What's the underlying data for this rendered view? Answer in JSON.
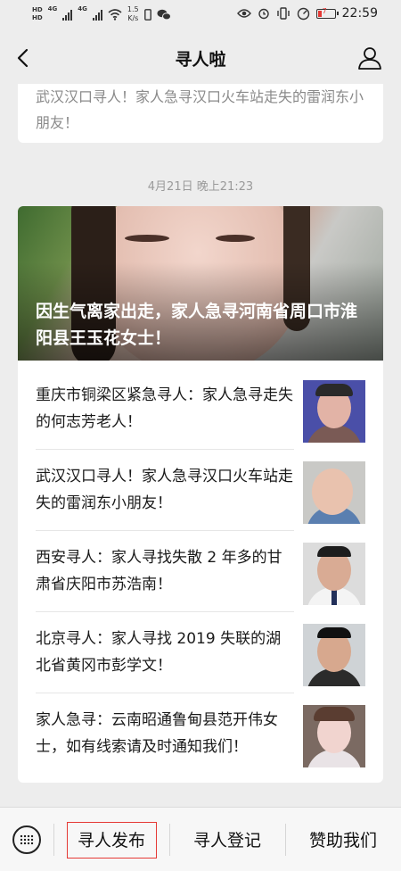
{
  "status_bar": {
    "net_speed_value": "1.5",
    "net_speed_unit": "K/s",
    "signal_label_1": "4G",
    "signal_label_2": "4G",
    "hd_label": "HD",
    "battery_level": "7",
    "time": "22:59"
  },
  "nav": {
    "title": "寻人啦"
  },
  "previous_message": {
    "text": "武汉汉口寻人！家人急寻汉口火车站走失的雷润东小朋友！"
  },
  "timestamp": "4月21日 晚上21:23",
  "article": {
    "hero_title": "因生气离家出走，家人急寻河南省周口市淮阳县王玉花女士！",
    "items": [
      {
        "text": "重庆市铜梁区紧急寻人：家人急寻走失的何志芳老人！"
      },
      {
        "text": "武汉汉口寻人！家人急寻汉口火车站走失的雷润东小朋友！"
      },
      {
        "text": "西安寻人：家人寻找失散 2 年多的甘肃省庆阳市苏浩南！"
      },
      {
        "text": "北京寻人：家人寻找 2019 失联的湖北省黄冈市彭学文！"
      },
      {
        "text": "家人急寻：云南昭通鲁甸县范开伟女士，如有线索请及时通知我们！"
      }
    ]
  },
  "bottom_menu": {
    "items": [
      {
        "label": "寻人发布"
      },
      {
        "label": "寻人登记"
      },
      {
        "label": "赞助我们"
      }
    ]
  },
  "colors": {
    "highlight": "#e53935",
    "background": "#ededed"
  }
}
